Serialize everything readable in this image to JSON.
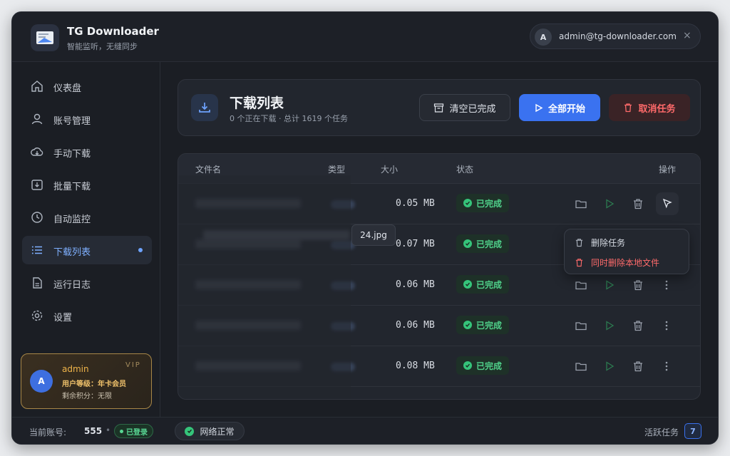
{
  "app": {
    "title": "TG Downloader",
    "subtitle": "智能监听，无缝同步"
  },
  "user": {
    "avatar": "A",
    "email": "admin@tg-downloader.com",
    "close": "×"
  },
  "sidebar": {
    "items": [
      {
        "label": "仪表盘",
        "icon": "home-icon"
      },
      {
        "label": "账号管理",
        "icon": "user-icon"
      },
      {
        "label": "手动下载",
        "icon": "cloud-download-icon"
      },
      {
        "label": "批量下载",
        "icon": "batch-download-icon"
      },
      {
        "label": "自动监控",
        "icon": "clock-icon"
      },
      {
        "label": "下载列表",
        "icon": "list-icon"
      },
      {
        "label": "运行日志",
        "icon": "file-icon"
      },
      {
        "label": "设置",
        "icon": "gear-icon"
      }
    ],
    "active_index": 5
  },
  "vip": {
    "avatar": "A",
    "name": "admin",
    "tag": "VIP",
    "level": "用户等级：年卡会员",
    "points": "剩余积分：无限"
  },
  "panel": {
    "title": "下载列表",
    "subtitle": "0 个正在下载 · 总计 1619 个任务",
    "clear_label": "清空已完成",
    "start_label": "全部开始",
    "cancel_label": "取消任务"
  },
  "table": {
    "headers": {
      "name": "文件名",
      "type": "类型",
      "size": "大小",
      "status": "状态",
      "actions": "操作"
    },
    "rows": [
      {
        "size": "0.05 MB",
        "status": "已完成"
      },
      {
        "size": "0.07 MB",
        "status": "已完成"
      },
      {
        "size": "0.06 MB",
        "status": "已完成"
      },
      {
        "size": "0.06 MB",
        "status": "已完成"
      },
      {
        "size": "0.08 MB",
        "status": "已完成"
      }
    ]
  },
  "tooltip": {
    "text": "24.jpg"
  },
  "context_menu": {
    "delete_task": "删除任务",
    "delete_with_file": "同时删除本地文件"
  },
  "footer": {
    "account_label": "当前账号:",
    "account_value": "555",
    "logged_in": "已登录",
    "network": "网络正常",
    "active_label": "活跃任务",
    "active_count": "7"
  },
  "colors": {
    "accent": "#3a72f0",
    "success": "#35c47a",
    "danger": "#ff6a6a",
    "vip_gold": "#f0b54a"
  }
}
